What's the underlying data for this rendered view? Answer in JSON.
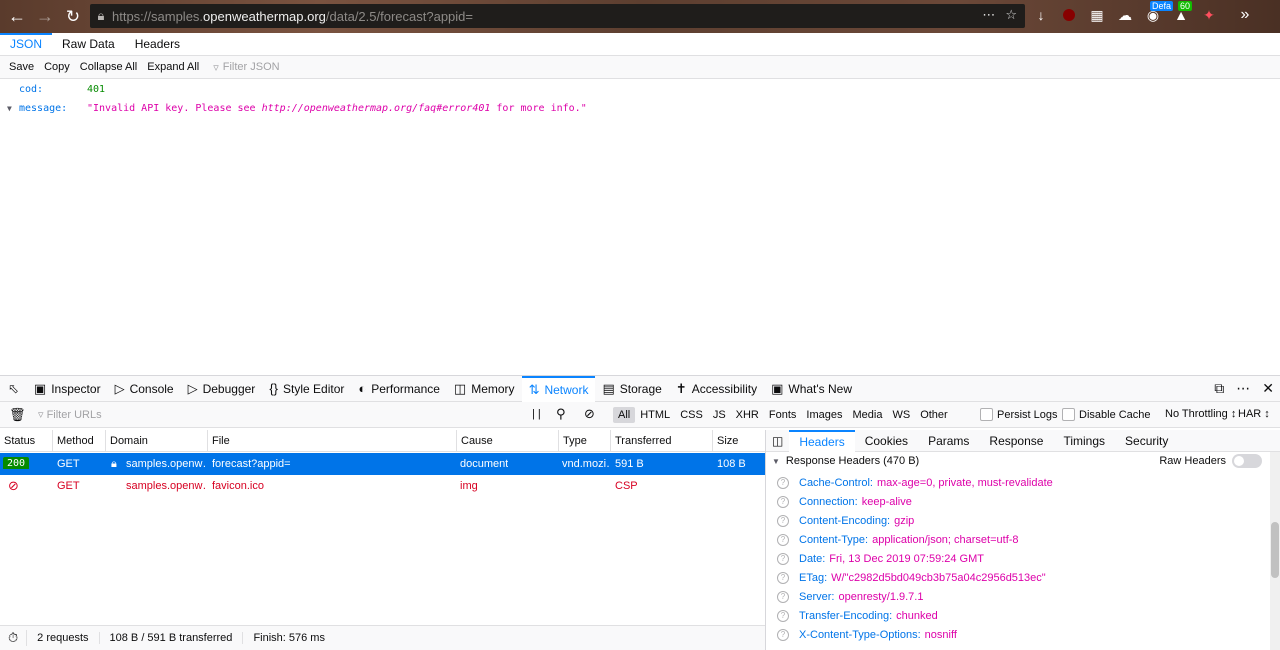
{
  "browser": {
    "url_prefix": "https://samples.",
    "url_host": "openweathermap.org",
    "url_path": "/data/2.5/forecast?appid=",
    "badge_defa": "Defa",
    "badge_60": "60"
  },
  "json_viewer": {
    "tabs": [
      "JSON",
      "Raw Data",
      "Headers"
    ],
    "toolbar": [
      "Save",
      "Copy",
      "Collapse All",
      "Expand All"
    ],
    "filter_placeholder": "Filter JSON",
    "rows": [
      {
        "key": "cod:",
        "value": "401"
      },
      {
        "key": "message:",
        "value_prefix": "\"Invalid API key. Please see ",
        "value_link": "http://openweathermap.org/faq#error401",
        "value_suffix": " for more info.\""
      }
    ]
  },
  "devtools": {
    "tabs": [
      "Inspector",
      "Console",
      "Debugger",
      "Style Editor",
      "Performance",
      "Memory",
      "Network",
      "Storage",
      "Accessibility",
      "What's New"
    ],
    "active_tab": "Network"
  },
  "network": {
    "filter_placeholder": "Filter URLs",
    "pause_label": "| |",
    "types": [
      "All",
      "HTML",
      "CSS",
      "JS",
      "XHR",
      "Fonts",
      "Images",
      "Media",
      "WS",
      "Other"
    ],
    "persist_logs": "Persist Logs",
    "disable_cache": "Disable Cache",
    "throttling": "No Throttling ↕",
    "har": "HAR ↕",
    "columns": [
      "Status",
      "Method",
      "Domain",
      "File",
      "Cause",
      "Type",
      "Transferred",
      "Size"
    ],
    "rows": [
      {
        "status": "200",
        "method": "GET",
        "domain": "samples.openw…",
        "file": "forecast?appid=",
        "cause": "document",
        "type": "vnd.mozi…",
        "transferred": "591 B",
        "size": "108 B"
      },
      {
        "status": "",
        "method": "GET",
        "domain": "samples.openw…",
        "file": "favicon.ico",
        "cause": "img",
        "type": "",
        "transferred": "CSP",
        "size": ""
      }
    ],
    "summary": {
      "requests": "2 requests",
      "transferred": "108 B / 591 B transferred",
      "finish": "Finish: 576 ms"
    }
  },
  "side_panel": {
    "tabs": [
      "Headers",
      "Cookies",
      "Params",
      "Response",
      "Timings",
      "Security"
    ],
    "section_title": "Response Headers (470 B)",
    "raw_headers": "Raw Headers",
    "headers": [
      {
        "name": "Cache-Control:",
        "value": "max-age=0, private, must-revalidate"
      },
      {
        "name": "Connection:",
        "value": "keep-alive"
      },
      {
        "name": "Content-Encoding:",
        "value": "gzip"
      },
      {
        "name": "Content-Type:",
        "value": "application/json; charset=utf-8"
      },
      {
        "name": "Date:",
        "value": "Fri, 13 Dec 2019 07:59:24 GMT"
      },
      {
        "name": "ETag:",
        "value": "W/\"c2982d5bd049cb3b75a04c2956d513ec\""
      },
      {
        "name": "Server:",
        "value": "openresty/1.9.7.1"
      },
      {
        "name": "Transfer-Encoding:",
        "value": "chunked"
      },
      {
        "name": "X-Content-Type-Options:",
        "value": "nosniff"
      }
    ]
  },
  "colors": {
    "accent": "#0a84ff",
    "selected_row": "#0074e8",
    "string": "#dd00a9",
    "key": "#0074e8",
    "number": "#058b00",
    "error": "#d70022"
  }
}
